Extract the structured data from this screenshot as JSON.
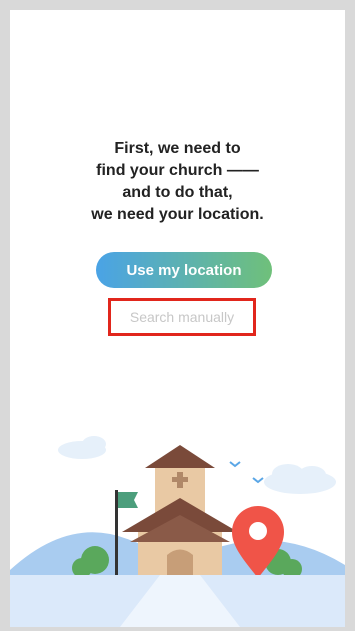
{
  "message": {
    "lines": [
      "First, we need to",
      "find your church ——",
      "and to do that,",
      "we need your location."
    ]
  },
  "actions": {
    "use_location_label": "Use my location",
    "search_manually_label": "Search manually"
  },
  "colors": {
    "gradient_start": "#4aa3e6",
    "gradient_end": "#6fc07a",
    "highlight": "#e1261c",
    "pin": "#f05448"
  },
  "illustration": {
    "icons": [
      "cloud-icon",
      "church-icon",
      "flag-icon",
      "bird-icon",
      "location-pin-icon",
      "tree-icon"
    ]
  }
}
